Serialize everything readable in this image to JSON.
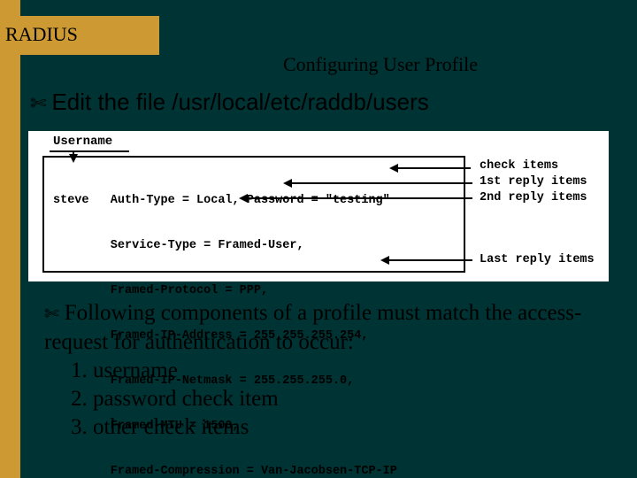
{
  "header": {
    "title": "RADIUS",
    "subtitle": "Configuring User Profile"
  },
  "bullet_icon": "✄",
  "edit_line": "Edit the file /usr/local/etc/raddb/users",
  "figure": {
    "username_label": "Username",
    "code_lines": [
      "steve   Auth-Type = Local, Password = \"testing\"",
      "        Service-Type = Framed-User,",
      "        Framed-Protocol = PPP,",
      "        Framed-IP-Address = 255.255.255.254,",
      "        Framed-IP-Netmask = 255.255.255.0,",
      "        Framed-MTU = 1500,",
      "        Framed-Compression = Van-Jacobsen-TCP-IP"
    ],
    "labels": {
      "check": "check items",
      "first_reply": "1st reply items",
      "second_reply": "2nd reply items",
      "last_reply": "Last reply items"
    }
  },
  "paragraph": {
    "lead": "Following components of a profile must match the access-request for authentication to occur:",
    "items": [
      "1. username",
      "2.  password check item",
      "3.  other check items"
    ]
  }
}
